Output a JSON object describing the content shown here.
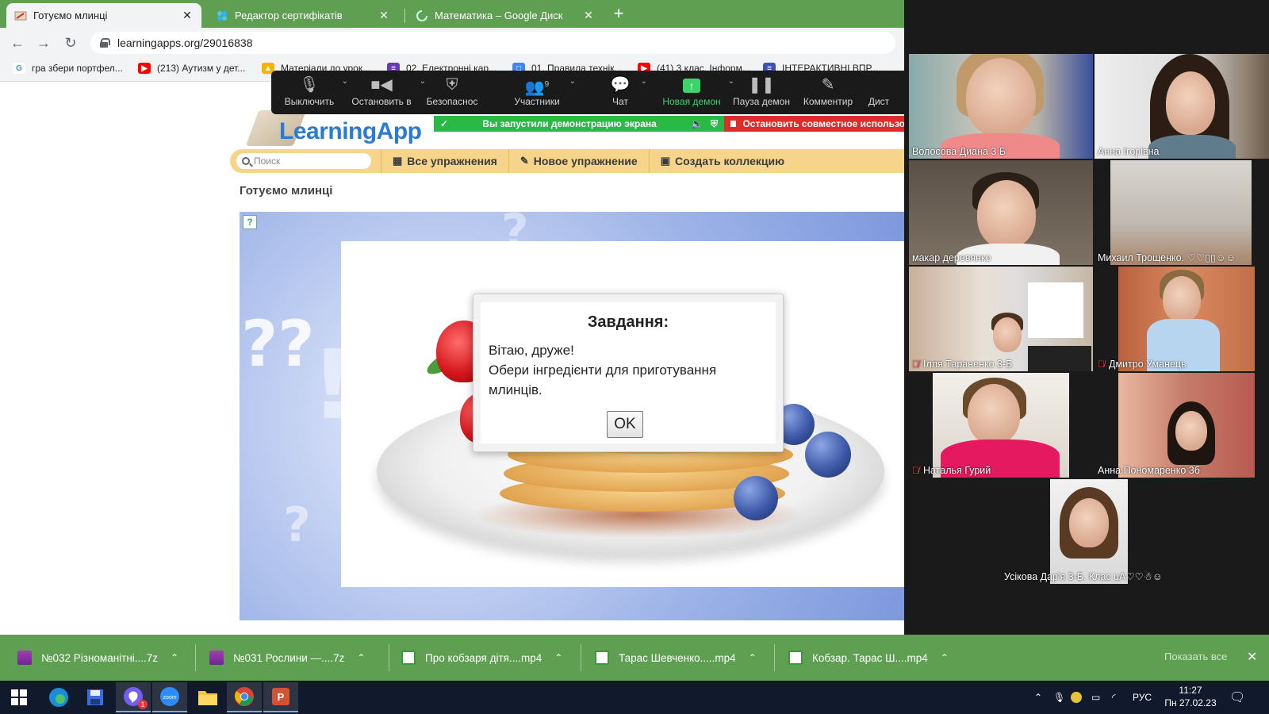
{
  "browser": {
    "tabs": [
      {
        "label": "Готуємо млинці",
        "active": true
      },
      {
        "label": "Редактор сертифікатів",
        "active": false
      },
      {
        "label": "Математика – Google Диск",
        "active": false
      }
    ],
    "new_tab": "+",
    "url": "learningapps.org/29016838",
    "bookmarks": [
      {
        "label": "гра збери портфел...",
        "icon": "google-icon"
      },
      {
        "label": "(213) Аутизм у дет...",
        "icon": "youtube-icon"
      },
      {
        "label": "Матеріали до урок...",
        "icon": "bookmark-icon"
      },
      {
        "label": "02. Електронні кар...",
        "icon": "form-icon"
      },
      {
        "label": "01. Правила технік...",
        "icon": "slides-icon"
      },
      {
        "label": "(41) 3 клас. Інформ...",
        "icon": "youtube-icon"
      },
      {
        "label": "ІНТЕРАКТИВНІ ВПР...",
        "icon": "form-icon"
      }
    ]
  },
  "site": {
    "logo": "LearningApp",
    "search_placeholder": "Поиск",
    "menu": [
      {
        "label": "Все упражнения",
        "icon": "grid-icon"
      },
      {
        "label": "Новое упражнение",
        "icon": "pencil-icon"
      },
      {
        "label": "Создать коллекцию",
        "icon": "collection-icon"
      }
    ],
    "page_title": "Готуємо млинці"
  },
  "dialog": {
    "title": "Завдання:",
    "line1": "Вітаю, друже!",
    "line2": "Обери інгредієнти для приготування млинців.",
    "ok": "OK"
  },
  "zoom_toolbar": {
    "buttons": [
      {
        "label": "Выключить",
        "icon": "microphone-icon"
      },
      {
        "label": "Остановить в",
        "icon": "video-camera-icon"
      },
      {
        "label": "Безопаснос",
        "icon": "shield-icon"
      },
      {
        "label": "Участники",
        "icon": "participants-icon",
        "count": "9"
      },
      {
        "label": "Чат",
        "icon": "chat-icon"
      },
      {
        "label": "Новая демон",
        "icon": "share-screen-icon"
      },
      {
        "label": "Пауза демон",
        "icon": "pause-icon"
      },
      {
        "label": "Комментир",
        "icon": "annotate-icon"
      },
      {
        "label": "Дист",
        "icon": "remote-control-icon"
      }
    ],
    "share_status": "Вы запустили демонстрацию экрана",
    "stop_share": "Остановить совместное использо"
  },
  "participants": [
    {
      "name": "Волосова Диана 3 Б",
      "muted": false,
      "active": false
    },
    {
      "name": "Анна Ігорівна",
      "muted": false,
      "active": true
    },
    {
      "name": "макар  деревянко",
      "muted": false,
      "active": false
    },
    {
      "name": "Михаил Трощенко. ♡♡▯▯☺☺",
      "muted": false,
      "active": false
    },
    {
      "name": "Ілля Тараненко 3-Б",
      "muted": true,
      "active": false
    },
    {
      "name": "Дмитро Уманець",
      "muted": true,
      "active": false
    },
    {
      "name": "Наталья Гурий",
      "muted": true,
      "active": false
    },
    {
      "name": "Анна Пономаренко 3б",
      "muted": false,
      "active": false
    },
    {
      "name": "Усікова Дар'я 3-Б. Клас uA♡♡☃☺",
      "muted": false,
      "active": false
    }
  ],
  "downloads": {
    "items": [
      {
        "label": "№032 Різноманітні....7z",
        "icon": "archive-icon"
      },
      {
        "label": "№031 Рослини —....7z",
        "icon": "archive-icon"
      },
      {
        "label": "Про кобзаря дітя....mp4",
        "icon": "video-file-icon"
      },
      {
        "label": "Тарас Шевченко.....mp4",
        "icon": "video-file-icon"
      },
      {
        "label": "Кобзар. Тарас Ш....mp4",
        "icon": "video-file-icon"
      }
    ],
    "show_all": "Показать все"
  },
  "taskbar": {
    "lang": "РУС",
    "time": "11:27",
    "date": "Пн 27.02.23",
    "viber_badge": "1"
  },
  "colors": {
    "chrome_green": "#5e9f52",
    "zoom_bg": "#1a1a1a",
    "share_green": "#28b947",
    "stop_red": "#e02b2b",
    "menu_yellow": "#f6d58a"
  }
}
